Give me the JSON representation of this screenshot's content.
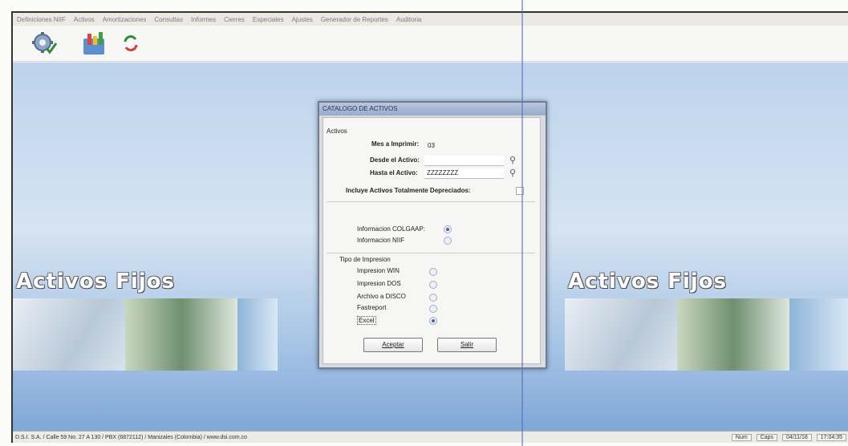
{
  "menu": [
    "Definiciones NIIF",
    "Activos",
    "Amortizaciones",
    "Consultas",
    "Informes",
    "Cierres",
    "Especiales",
    "Ajustes",
    "Generador de Reportes",
    "Auditoria"
  ],
  "banner": {
    "title": "Activos Fijos"
  },
  "dialog": {
    "title": "CATALOGO DE ACTIVOS",
    "section_activos": "Activos",
    "mes_label": "Mes a Imprimir:",
    "mes_value": "03",
    "desde_label": "Desde el Activo:",
    "desde_value": "",
    "hasta_label": "Hasta el Activo:",
    "hasta_value": "ZZZZZZZZ",
    "incluye_label": "Incluye Activos Totalmente Depreciados:",
    "incluye_checked": false,
    "info_options": [
      {
        "label": "Informacion COLGAAP:",
        "selected": true
      },
      {
        "label": "Informacion NIIF",
        "selected": false
      }
    ],
    "section_tipo": "Tipo de Impresion",
    "print_options": [
      {
        "label": "Impresion WIN",
        "selected": false
      },
      {
        "label": "Impresion DOS",
        "selected": false
      },
      {
        "label": "Archivo a DISCO",
        "selected": false
      },
      {
        "label": "Fastreport",
        "selected": false
      },
      {
        "label": "Excel",
        "selected": true
      }
    ],
    "accept_label": "Aceptar",
    "exit_label": "Salir"
  },
  "status": {
    "company": "D.S.I. S.A. / Calle 59 No. 27 A 130 / PBX (6872112) / Manizales (Colombia) / www.dsi.com.co",
    "num": "Num",
    "caps": "Caps",
    "date": "04/11/18",
    "time": "17:04:35"
  },
  "colors": {
    "accent": "#3a64b4",
    "background_top": "#bcd3ec",
    "background_bottom": "#7fa7d8"
  }
}
